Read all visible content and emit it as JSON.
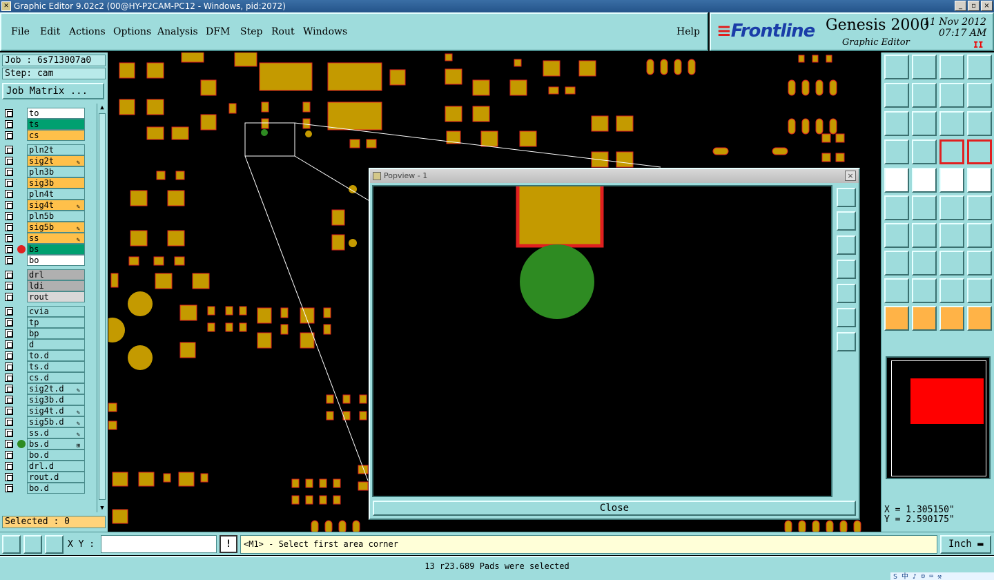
{
  "window": {
    "title": "Graphic Editor 9.02c2 (00@HY-P2CAM-PC12 - Windows, pid:2072)",
    "buttons": [
      "_",
      "▫",
      "×"
    ]
  },
  "menu": {
    "items": [
      "File",
      "Edit",
      "Actions",
      "Options",
      "Analysis",
      "DFM",
      "Step",
      "Rout",
      "Windows"
    ],
    "help": "Help"
  },
  "brand": {
    "logo": "Frontline",
    "product": "Genesis 2000",
    "subtitle": "Graphic Editor",
    "date": "11 Nov 2012",
    "time": "07:17 AM",
    "pause": "II"
  },
  "left": {
    "job": "Job : 6s713007a0",
    "step": "Step: cam",
    "job_matrix": "Job Matrix ...",
    "selected": "Selected : 0"
  },
  "layers": [
    {
      "name": "to",
      "color": "#ffffff"
    },
    {
      "name": "ts",
      "color": "#00a070"
    },
    {
      "name": "cs",
      "color": "#ffc04a"
    },
    {
      "name": "pln2t",
      "color": "#9edcdc"
    },
    {
      "name": "sig2t",
      "color": "#ffc04a",
      "flag": "✎"
    },
    {
      "name": "pln3b",
      "color": "#9edcdc"
    },
    {
      "name": "sig3b",
      "color": "#ffc04a"
    },
    {
      "name": "pln4t",
      "color": "#9edcdc"
    },
    {
      "name": "sig4t",
      "color": "#ffc04a",
      "flag": "✎"
    },
    {
      "name": "pln5b",
      "color": "#9edcdc"
    },
    {
      "name": "sig5b",
      "color": "#ffc04a",
      "flag": "✎"
    },
    {
      "name": "ss",
      "color": "#ffc04a",
      "flag": "✎"
    },
    {
      "name": "bs",
      "color": "#00a070",
      "dot": "#e02020"
    },
    {
      "name": "bo",
      "color": "#ffffff"
    },
    {
      "name": "drl",
      "color": "#b0b0b0"
    },
    {
      "name": "ldi",
      "color": "#b0b0b0"
    },
    {
      "name": "rout",
      "color": "#d8d8d8"
    },
    {
      "name": "cvia",
      "color": "#9edcdc"
    },
    {
      "name": "tp",
      "color": "#9edcdc"
    },
    {
      "name": "bp",
      "color": "#9edcdc"
    },
    {
      "name": "d",
      "color": "#9edcdc"
    },
    {
      "name": "to.d",
      "color": "#9edcdc"
    },
    {
      "name": "ts.d",
      "color": "#9edcdc"
    },
    {
      "name": "cs.d",
      "color": "#9edcdc"
    },
    {
      "name": "sig2t.d",
      "color": "#9edcdc",
      "flag": "✎"
    },
    {
      "name": "sig3b.d",
      "color": "#9edcdc"
    },
    {
      "name": "sig4t.d",
      "color": "#9edcdc",
      "flag": "✎"
    },
    {
      "name": "sig5b.d",
      "color": "#9edcdc",
      "flag": "✎"
    },
    {
      "name": "ss.d",
      "color": "#9edcdc",
      "flag": "✎"
    },
    {
      "name": "bs.d",
      "color": "#9edcdc",
      "dot": "#2e8b22",
      "flag": "⊞"
    },
    {
      "name": "bo.d",
      "color": "#9edcdc"
    },
    {
      "name": "drl.d",
      "color": "#9edcdc"
    },
    {
      "name": "rout.d",
      "color": "#9edcdc"
    },
    {
      "name": "bo.d",
      "color": "#9edcdc"
    }
  ],
  "popview": {
    "title": "Popview - 1",
    "close_x": "×",
    "close_button": "Close"
  },
  "coords": {
    "x": "X = 1.305150\"",
    "y": "Y = 2.590175\""
  },
  "command": {
    "xy_label": "X Y :",
    "xy_value": "",
    "excl": "!",
    "prompt": "<M1> - Select first area corner",
    "units": "Inch"
  },
  "status": {
    "text": "13 r23.689 Pads were selected",
    "tray": "S 中 ♪ ☺ ⌨ ⚒"
  },
  "colors": {
    "pad": "#c49a00",
    "pad_border": "#e02020",
    "via": "#2e8b22",
    "panel": "#9edcdc"
  }
}
